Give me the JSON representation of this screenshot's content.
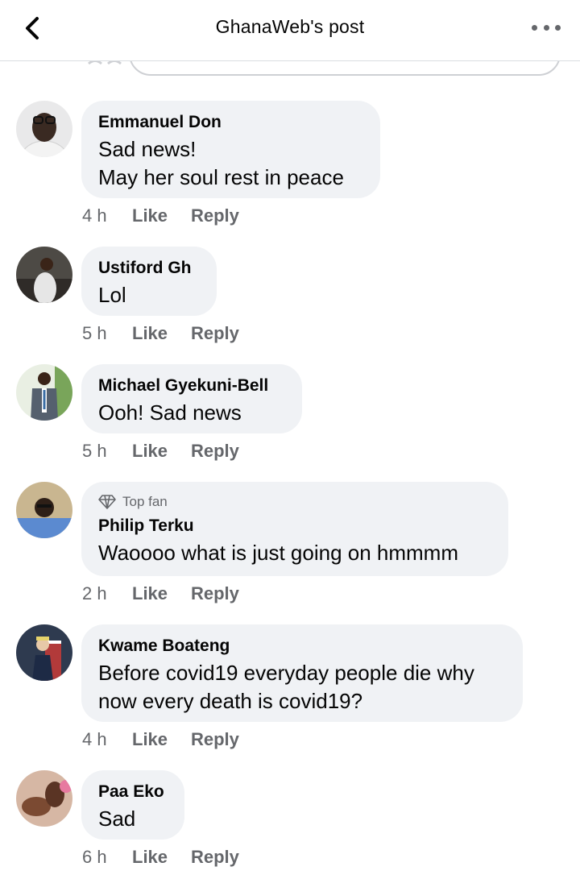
{
  "header": {
    "title": "GhanaWeb's post"
  },
  "comments": [
    {
      "name": "Emmanuel Don",
      "lines": [
        "Sad news!",
        "May her soul rest in peace"
      ],
      "time": "4 h",
      "like": "Like",
      "reply": "Reply"
    },
    {
      "name": "Ustiford Gh",
      "lines": [
        "Lol"
      ],
      "time": "5 h",
      "like": "Like",
      "reply": "Reply"
    },
    {
      "name": "Michael Gyekuni-Bell",
      "lines": [
        "Ooh! Sad news"
      ],
      "time": "5 h",
      "like": "Like",
      "reply": "Reply"
    },
    {
      "badge": "Top fan",
      "name": "Philip Terku",
      "lines": [
        "Waoooo what is just going on hmmmm"
      ],
      "time": "2 h",
      "like": "Like",
      "reply": "Reply"
    },
    {
      "name": "Kwame Boateng",
      "lines": [
        "Before covid19 everyday people die why",
        "now every death is covid19?"
      ],
      "time": "4 h",
      "like": "Like",
      "reply": "Reply"
    },
    {
      "name": "Paa Eko",
      "lines": [
        "Sad"
      ],
      "time": "6 h",
      "like": "Like",
      "reply": "Reply"
    }
  ],
  "icons": {
    "back": "chevron-left-icon",
    "more": "more-horizontal-icon",
    "badge": "diamond-icon"
  },
  "colors": {
    "bubble": "#f0f2f5",
    "meta": "#65676b",
    "text": "#050505"
  }
}
